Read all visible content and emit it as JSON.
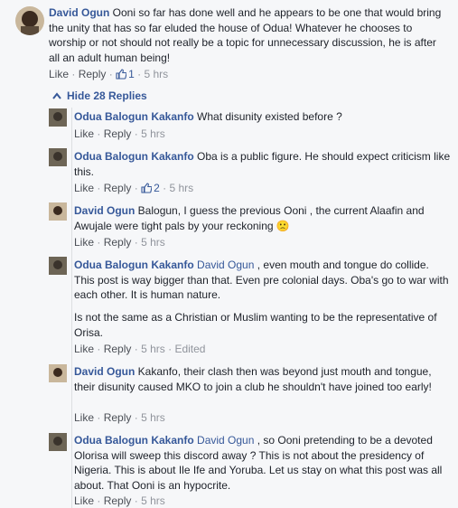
{
  "main_comment": {
    "author": "David Ogun",
    "text": " Ooni so far has done well and he appears to be one that would bring the unity that has so far eluded the house of Odua! Whatever he chooses to worship or not should not really be a topic for unnecessary discussion, he is after all an adult human being!",
    "like_label": "Like",
    "reply_label": "Reply",
    "like_count": "1",
    "time": "5 hrs"
  },
  "hide_replies_label": "Hide 28 Replies",
  "replies": [
    {
      "author": "Odua Balogun Kakanfo",
      "mention": "",
      "text": " What disunity existed before ?",
      "like_label": "Like",
      "reply_label": "Reply",
      "like_count": "",
      "time": "5 hrs",
      "edited": ""
    },
    {
      "author": "Odua Balogun Kakanfo",
      "mention": "",
      "text": " Oba is a public figure. He should expect criticism like this.",
      "like_label": "Like",
      "reply_label": "Reply",
      "like_count": "2",
      "time": "5 hrs",
      "edited": ""
    },
    {
      "author": "David Ogun",
      "mention": "",
      "text": " Balogun, I guess the previous Ooni , the current Alaafin and Awujale were tight pals by your reckoning",
      "emoji": "🙁",
      "like_label": "Like",
      "reply_label": "Reply",
      "like_count": "",
      "time": "5 hrs",
      "edited": ""
    },
    {
      "author": "Odua Balogun Kakanfo",
      "mention": " David Ogun",
      "text": " , even mouth and tongue do collide. This post is way bigger than that. Even pre colonial days. Oba's go to war with each other. It is human nature.",
      "text2": "Is not the same as a Christian or Muslim wanting to be the representative of Orisa.",
      "like_label": "Like",
      "reply_label": "Reply",
      "like_count": "",
      "time": "5 hrs",
      "edited": "Edited"
    },
    {
      "author": "David Ogun",
      "mention": "",
      "text": " Kakanfo, their clash then was beyond just mouth and tongue, their disunity caused MKO to join a club he shouldn't have joined too early!",
      "like_label": "Like",
      "reply_label": "Reply",
      "like_count": "",
      "time": "5 hrs",
      "edited": ""
    },
    {
      "author": "Odua Balogun Kakanfo",
      "mention": " David Ogun",
      "text": " , so Ooni pretending to be a devoted Olorisa will sweep this discord away ? This is not about the presidency of Nigeria. This is about Ile Ife and Yoruba. Let us stay on what this post was all about. That Ooni is an hypocrite.",
      "like_label": "Like",
      "reply_label": "Reply",
      "like_count": "",
      "time": "5 hrs",
      "edited": ""
    }
  ],
  "separator": "·"
}
